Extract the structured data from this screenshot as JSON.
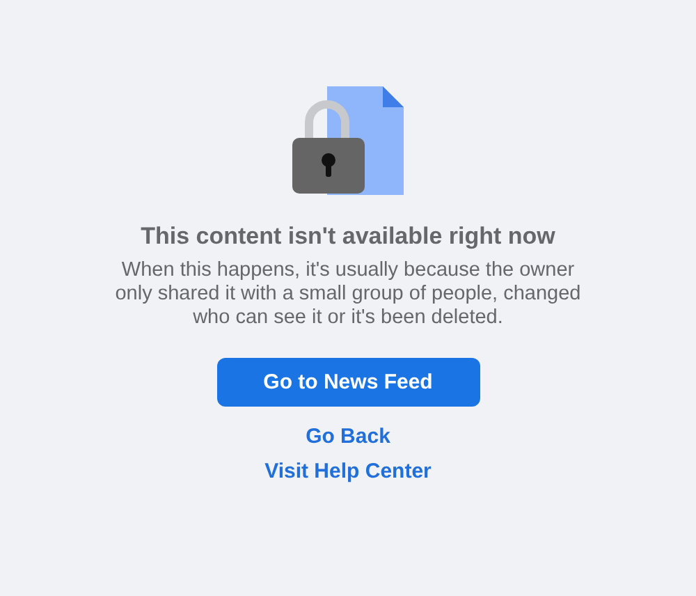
{
  "title": "This content isn't available right now",
  "message": "When this happens, it's usually because the owner only shared it with a small group of people, changed who can see it or it's been deleted.",
  "primary_button": "Go to News Feed",
  "links": [
    "Go Back",
    "Visit Help Center"
  ]
}
